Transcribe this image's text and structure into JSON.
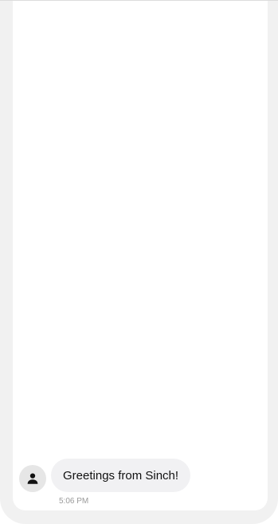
{
  "messages": [
    {
      "sender_icon": "person-icon",
      "text": "Greetings from Sinch!",
      "time": "5:06 PM"
    }
  ],
  "colors": {
    "frame": "#f1f1f1",
    "bubble": "#f1f1f3",
    "avatar": "#e6e6e6",
    "timestamp": "#9a9a9a"
  }
}
